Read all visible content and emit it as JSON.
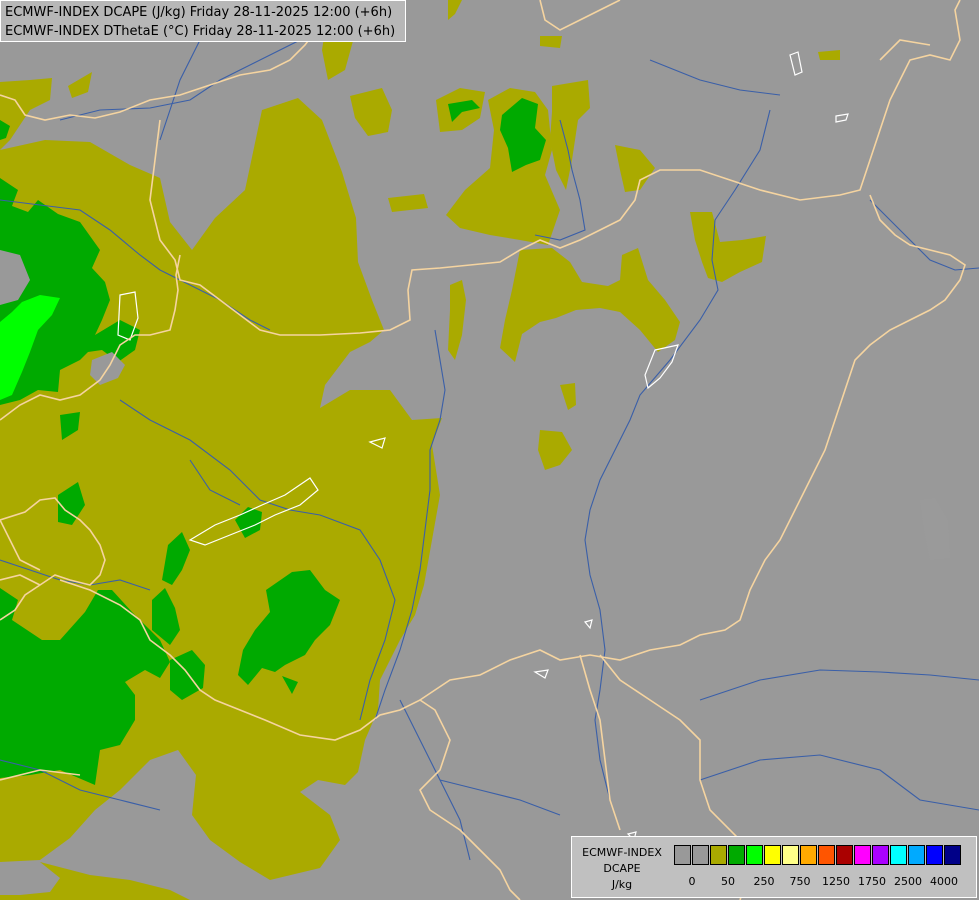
{
  "header": {
    "line1": "ECMWF-INDEX DCAPE (J/kg) Friday 28-11-2025 12:00 (+6h)",
    "line2": "ECMWF-INDEX DThetaE (°C) Friday 28-11-2025 12:00 (+6h)"
  },
  "map": {
    "background_color": "#999999",
    "fill_colors": {
      "level_0_50": "#aaaa00",
      "level_50_250": "#00aa00",
      "level_250_750": "#00ff00"
    },
    "border_color": "#f5d4a0",
    "river_color": "#3a5fa8",
    "lake_color": "#ffffff"
  },
  "legend": {
    "title_line1": "ECMWF-INDEX",
    "title_line2": "DCAPE",
    "title_line3": "J/kg",
    "colors": [
      "#999999",
      "#999999",
      "#aaaa00",
      "#00aa00",
      "#00ff00",
      "#ffff00",
      "#ffff88",
      "#ffaa00",
      "#ff5500",
      "#aa0000",
      "#ff00ff",
      "#aa00ff",
      "#00ffff",
      "#00aaff",
      "#0000ff",
      "#000088"
    ],
    "tick_labels": [
      "0",
      "50",
      "250",
      "750",
      "1250",
      "1750",
      "2500",
      "4000"
    ]
  }
}
